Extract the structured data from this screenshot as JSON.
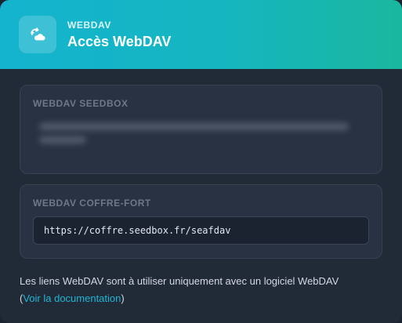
{
  "header": {
    "eyebrow": "WEBDAV",
    "title": "Accès WebDAV",
    "icon": "cloud-sync-icon"
  },
  "seedbox": {
    "label": "WEBDAV SEEDBOX"
  },
  "vault": {
    "label": "WEBDAV COFFRE-FORT",
    "url": "https://coffre.seedbox.fr/seafdav"
  },
  "footer": {
    "note": "Les liens WebDAV sont à utiliser uniquement avec un logiciel WebDAV",
    "paren_open": "(",
    "link_text": "Voir la documentation",
    "paren_close": ")"
  },
  "colors": {
    "accent": "#14b3cf",
    "accent_end": "#1ab79f",
    "link": "#22b5d3"
  }
}
